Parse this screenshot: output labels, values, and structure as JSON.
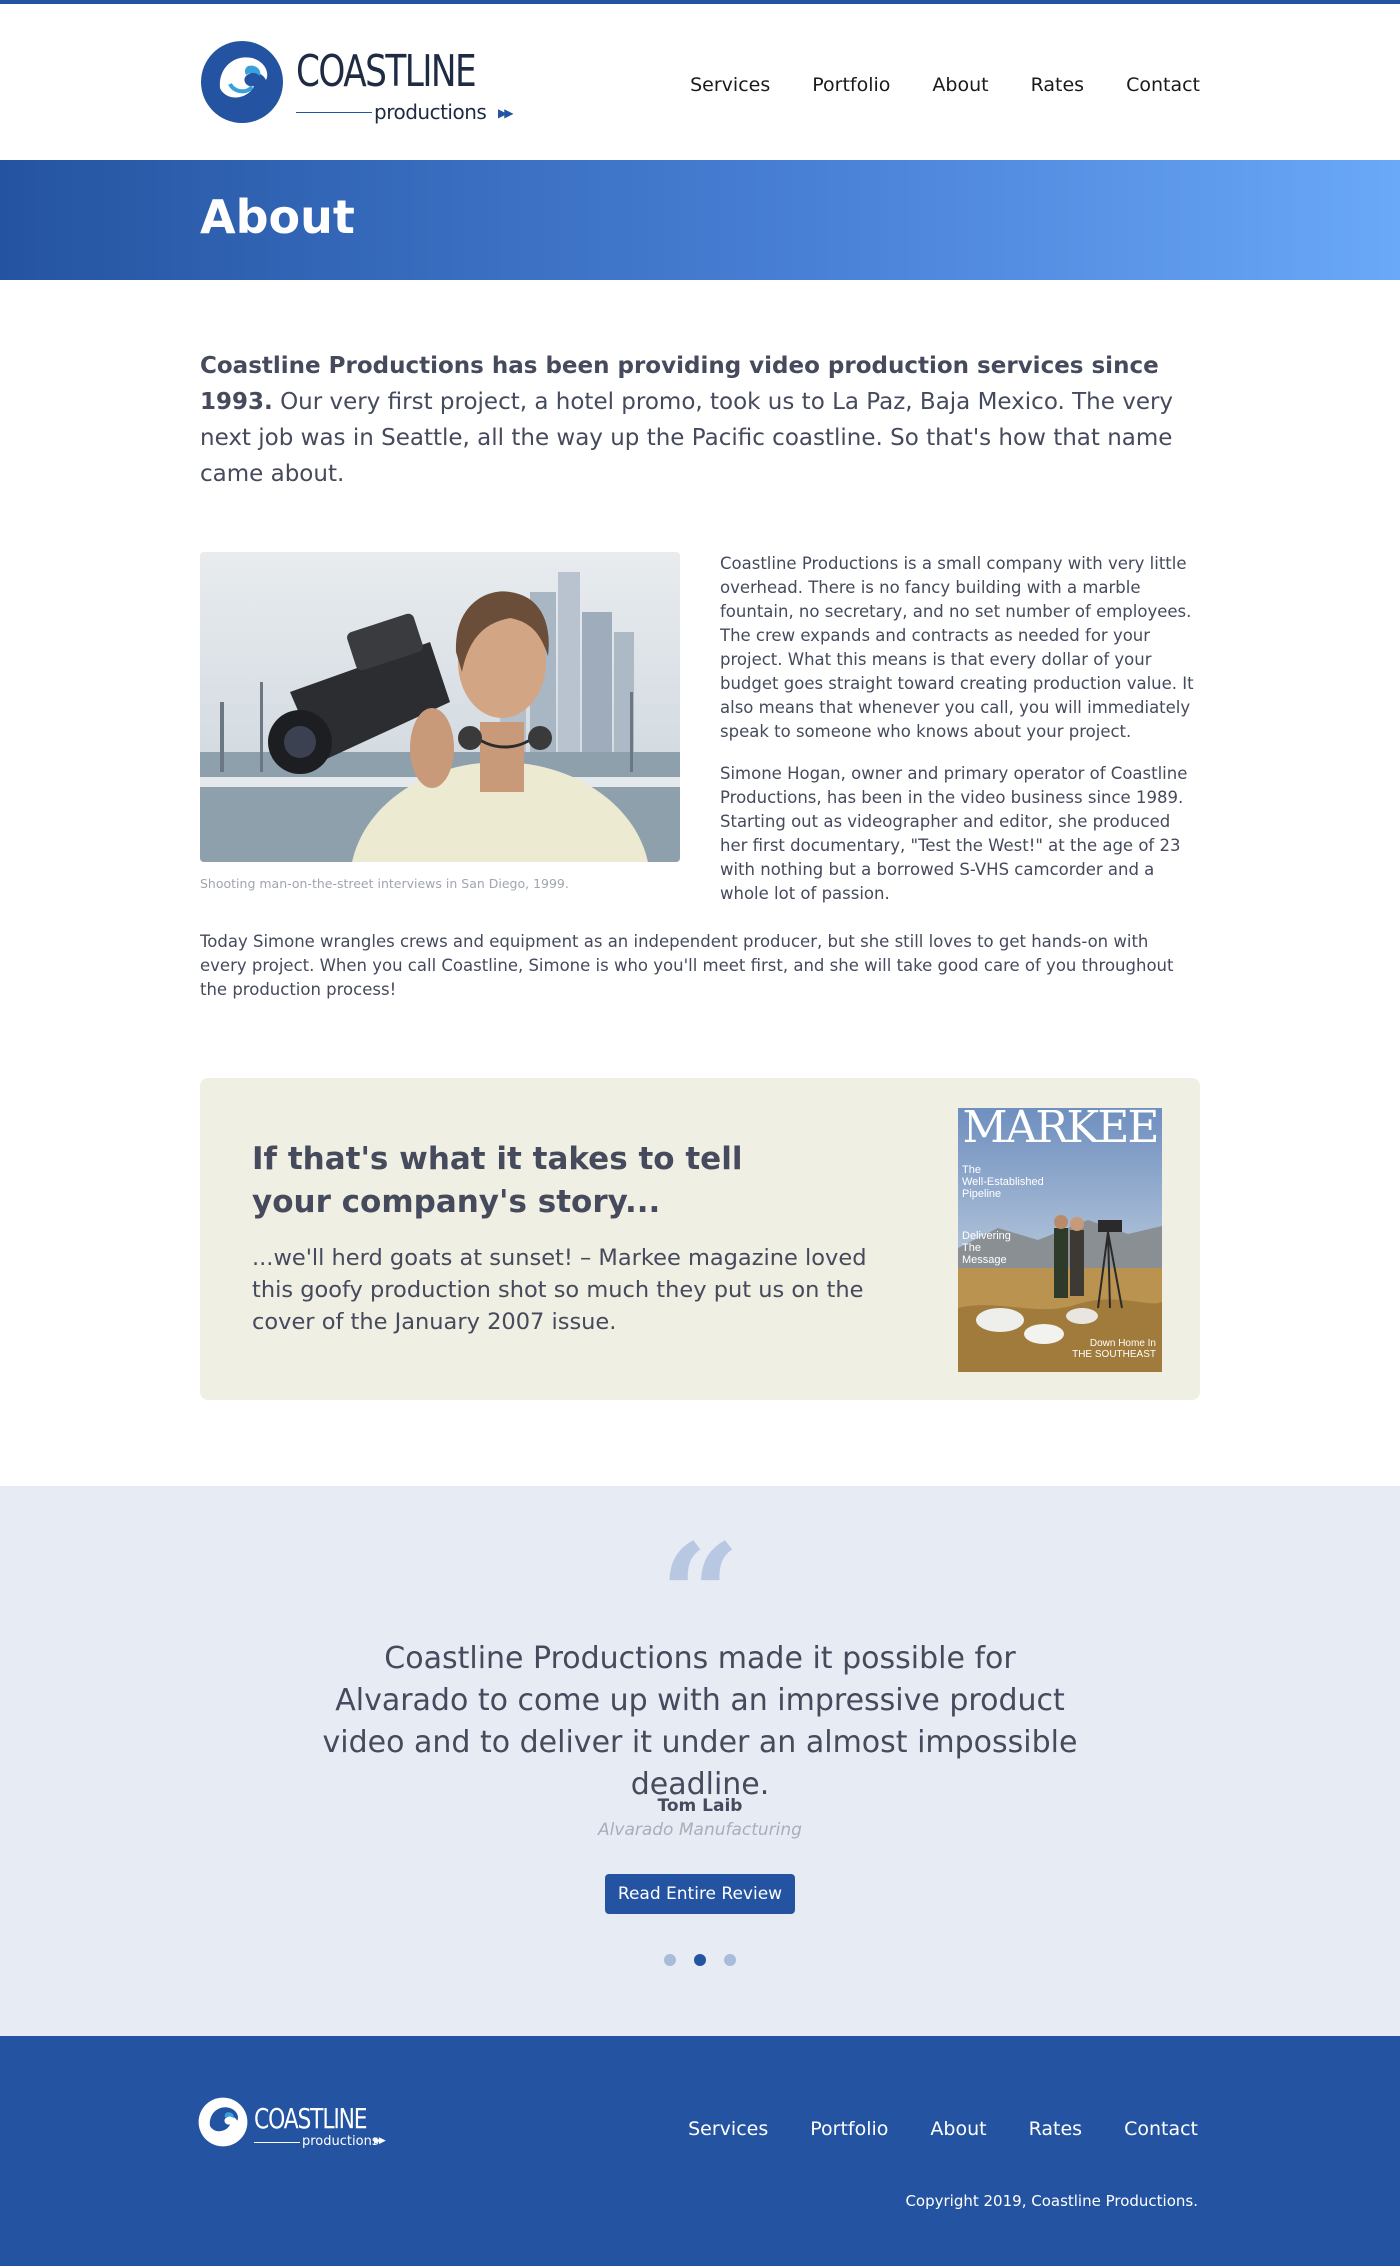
{
  "header": {
    "logo": {
      "word": "COASTLINE",
      "sub": "productions"
    },
    "nav": [
      "Services",
      "Portfolio",
      "About",
      "Rates",
      "Contact"
    ]
  },
  "hero": {
    "title": "About"
  },
  "content": {
    "lead_bold": "Coastline Productions has been providing video production services since 1993.",
    "lead_rest": " Our very first project, a hotel promo, took us to La Paz, Baja Mexico. The very next job was in Seattle, all the way up the Pacific coastline. So that's how that name came about.",
    "photo_caption": "Shooting man-on-the-street interviews in San Diego, 1999.",
    "para1": "Coastline Productions is a small company with very little overhead. There is no fancy building with a marble fountain, no secretary, and no set number of employees. The crew expands and contracts as needed for your project. What this means is that every dollar of your budget goes straight toward creating production value. It also means that whenever you call, you will immediately speak to someone who knows about your project.",
    "para2": "Simone Hogan, owner and primary operator of Coastline Productions, has been in the video business since 1989. Starting out as videographer and editor, she produced her first documentary, \"Test the West!\" at the age of 23 with nothing but a borrowed S-VHS camcorder and a whole lot of passion.",
    "para3": "Today Simone wrangles crews and equipment as an independent producer, but she still loves to get hands-on with every project. When you call Coastline, Simone is who you'll meet first, and she will take good care of you throughout the production process!"
  },
  "callout": {
    "heading": "If that's what it takes to tell your company's story...",
    "text": "...we'll herd goats at sunset! – Markee magazine loved this goofy production shot so much they put us on the cover of the January 2007 issue.",
    "magazine": {
      "title": "MARKEE",
      "line1": "The",
      "line2": "Well-Established",
      "line3": "Pipeline",
      "line4": "Delivering",
      "line5": "The",
      "line6": "Message",
      "foot1": "Down Home In",
      "foot2": "THE SOUTHEAST"
    }
  },
  "testimonial": {
    "quote": "Coastline Productions made it possible for Alvarado to come up with an impressive product video and to deliver it under an almost impossible deadline.",
    "name": "Tom Laib",
    "company": "Alvarado Manufacturing",
    "button": "Read Entire Review",
    "active_slide": 2,
    "slide_count": 3
  },
  "footer": {
    "logo": {
      "word": "COASTLINE",
      "sub": "productions"
    },
    "nav": [
      "Services",
      "Portfolio",
      "About",
      "Rates",
      "Contact"
    ],
    "copyright": "Copyright 2019, Coastline Productions."
  },
  "colors": {
    "brand": "#2454a1",
    "text": "#454a5c",
    "callout_bg": "#f0efe3",
    "testimonial_bg": "#e7ebf3"
  }
}
